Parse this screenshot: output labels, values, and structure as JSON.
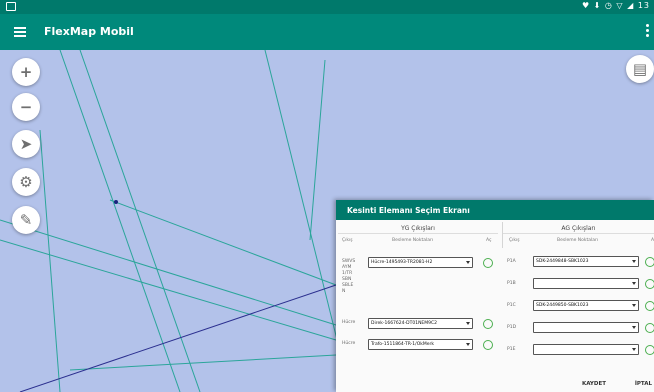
{
  "status_bar": {
    "right_text": "♥ ⬇ ◷ ▽ ◢ 13"
  },
  "app_bar": {
    "title": "FlexMap Mobil"
  },
  "map": {
    "buttons": [
      {
        "name": "zoom-in-button",
        "glyph": "+"
      },
      {
        "name": "zoom-out-button",
        "glyph": "−"
      },
      {
        "name": "locate-button",
        "glyph": "➤"
      },
      {
        "name": "settings-button",
        "glyph": "⚙"
      },
      {
        "name": "edit-button",
        "glyph": "✎"
      }
    ],
    "layers_glyph": "▤"
  },
  "dialog": {
    "title": "Kesinti Elemanı Seçim Ekranı",
    "yg": {
      "title": "YG Çıkışları",
      "col_cikis": "Çıkış",
      "col_besleme": "Besleme Noktaları",
      "col_ac": "Aç",
      "rows": [
        {
          "label": "SWVS\nAYM\n1/TR\nSBN\nSBLE\nN",
          "value": "Hücre-1495493-TR2081-H2"
        },
        {
          "label": "Hücre",
          "value": "Direk-1667624-DT01NEM9C2"
        },
        {
          "label": "Hücre",
          "value": "Trafo-1511864-TR-1/OkMerk"
        }
      ]
    },
    "ag": {
      "title": "AG Çıkışları",
      "col_cikis": "Çıkış",
      "col_besleme": "Besleme Noktaları",
      "col_ac": "A",
      "rows": [
        {
          "label": "P1A",
          "value": "SDK-2449848-SBK1023"
        },
        {
          "label": "P1B",
          "value": ""
        },
        {
          "label": "P1C",
          "value": "SDK-2449850-SBK1023"
        },
        {
          "label": "P1D",
          "value": ""
        },
        {
          "label": "P1E",
          "value": ""
        }
      ]
    },
    "save_label": "KAYDET",
    "cancel_label": "İPTAL"
  },
  "colors": {
    "appbar": "#00897b",
    "statusbar": "#00796b",
    "map_bg": "#b3c2ea",
    "radio": "#4caf50"
  }
}
